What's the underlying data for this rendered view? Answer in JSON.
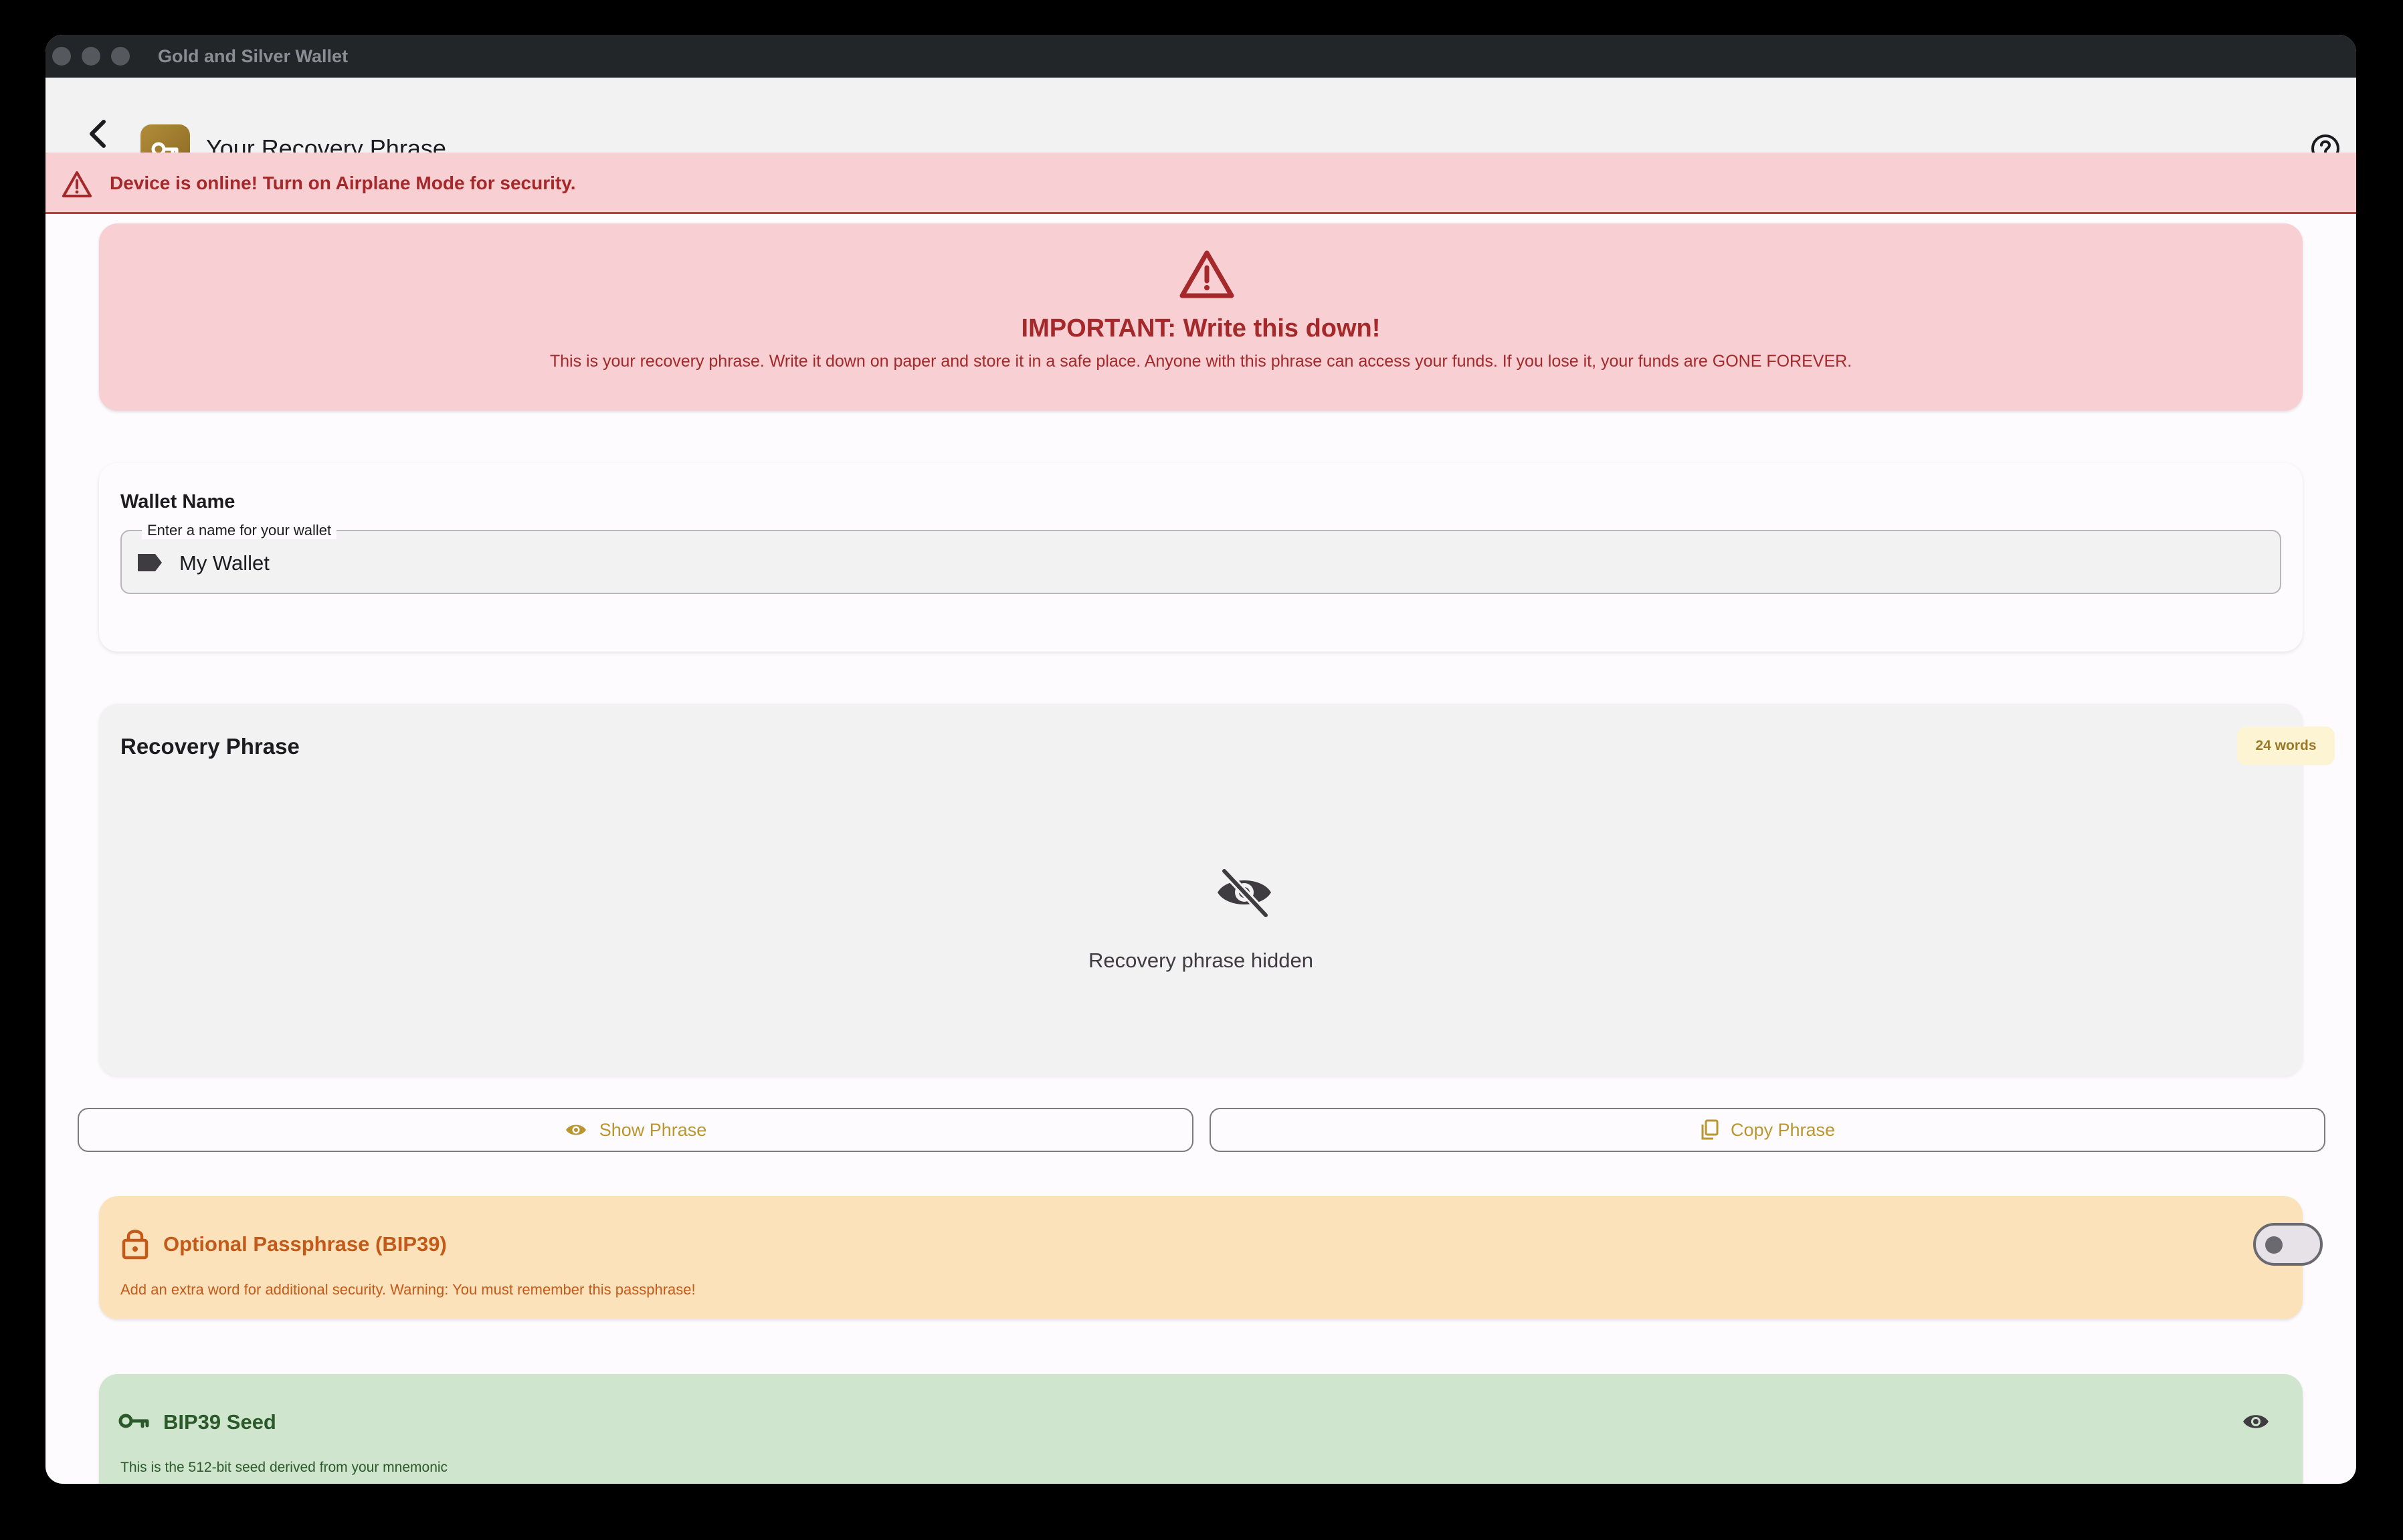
{
  "window": {
    "title": "Gold and Silver Wallet"
  },
  "appbar": {
    "title": "Your Recovery Phrase"
  },
  "banner": {
    "text": "Device is online! Turn on Airplane Mode for security."
  },
  "warning_card": {
    "title": "IMPORTANT: Write this down!",
    "body": "This is your recovery phrase. Write it down on paper and store it in a safe place. Anyone with this phrase can access your funds. If you lose it, your funds are GONE FOREVER."
  },
  "wallet_name": {
    "label": "Wallet Name",
    "field_label": "Enter a name for your wallet",
    "value": "My Wallet"
  },
  "recovery_phrase": {
    "title": "Recovery Phrase",
    "word_count_badge": "24 words",
    "hidden_text": "Recovery phrase hidden"
  },
  "actions": {
    "show_label": "Show Phrase",
    "copy_label": "Copy Phrase"
  },
  "passphrase": {
    "title": "Optional Passphrase (BIP39)",
    "description": "Add an extra word for additional security. Warning: You must remember this passphrase!",
    "enabled": false
  },
  "seed": {
    "title": "BIP39 Seed",
    "description": "This is the 512-bit seed derived from your mnemonic"
  },
  "icons": {
    "back": "back-arrow-icon",
    "logo": "key-icon",
    "help": "help-circle-icon",
    "banner": "warning-triangle-icon",
    "phrase_hidden": "eye-off-icon",
    "show": "eye-icon",
    "copy": "copy-icon",
    "passphrase": "lock-icon",
    "seed": "key-icon",
    "seed_toggle": "eye-icon"
  },
  "colors": {
    "accent_gold": "#b99630",
    "danger": "#a5282a",
    "danger_bg": "#f8cfd2",
    "warning_bg": "#fbe2bb",
    "warning_text": "#c45a1a",
    "success_bg": "#cfe5ce",
    "success_text": "#2b5a2a"
  }
}
